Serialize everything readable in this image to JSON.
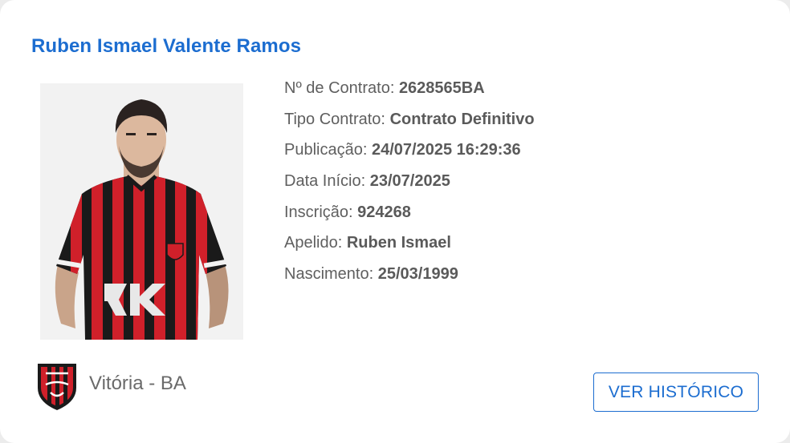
{
  "player": {
    "name": "Ruben Ismael Valente Ramos"
  },
  "details": [
    {
      "label": "Nº de Contrato:",
      "value": "2628565BA"
    },
    {
      "label": "Tipo Contrato:",
      "value": "Contrato Definitivo"
    },
    {
      "label": "Publicação:",
      "value": "24/07/2025 16:29:36"
    },
    {
      "label": "Data Início:",
      "value": "23/07/2025"
    },
    {
      "label": "Inscrição:",
      "value": "924268"
    },
    {
      "label": "Apelido:",
      "value": "Ruben Ismael"
    },
    {
      "label": "Nascimento:",
      "value": "25/03/1999"
    }
  ],
  "club": {
    "name": "Vitória - BA",
    "crest_icon": "club-crest-icon"
  },
  "actions": {
    "history_label": "VER HISTÓRICO"
  },
  "colors": {
    "accent": "#1c6dd0",
    "jersey_red": "#d0202a",
    "jersey_black": "#1a1a1a"
  }
}
